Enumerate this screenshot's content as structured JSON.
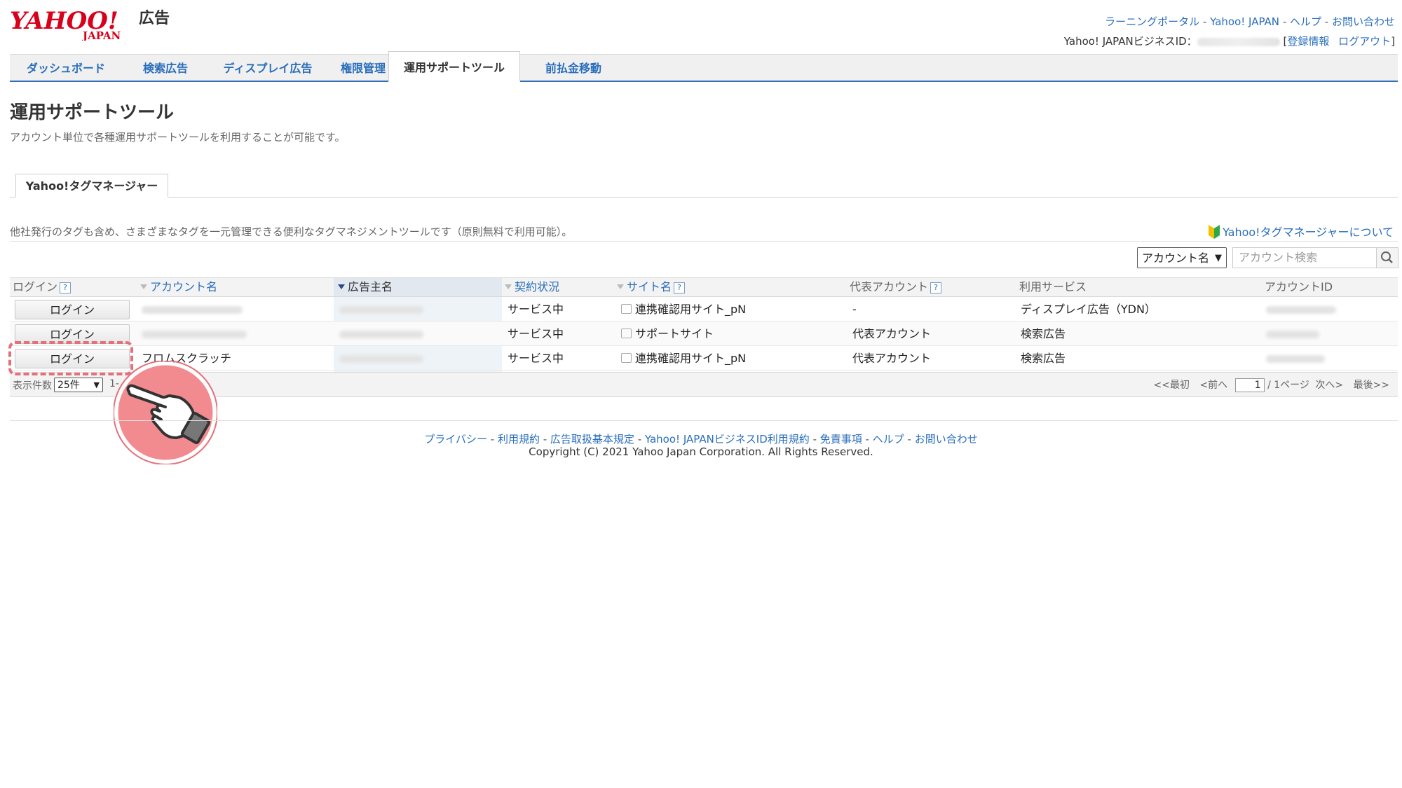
{
  "header": {
    "logo_main": "YAHOO!",
    "logo_sub": "JAPAN",
    "logo_suffix": "広告",
    "links": [
      "ラーニングポータル",
      "Yahoo! JAPAN",
      "ヘルプ",
      "お問い合わせ"
    ],
    "id_label": "Yahoo! JAPANビジネスID：",
    "account_info": "登録情報",
    "logout": "ログアウト"
  },
  "nav": {
    "tabs": [
      "ダッシュボード",
      "検索広告",
      "ディスプレイ広告",
      "権限管理",
      "運用サポートツール",
      "前払金移動"
    ],
    "active": "運用サポートツール"
  },
  "page": {
    "title": "運用サポートツール",
    "description": "アカウント単位で各種運用サポートツールを利用することが可能です。",
    "subtab": "Yahoo!タグマネージャー",
    "intro": "他社発行のタグも含め、さまざまなタグを一元管理できる便利なタグマネジメントツールです（原則無料で利用可能）。",
    "about_link": "Yahoo!タグマネージャーについて"
  },
  "search": {
    "select_value": "アカウント名",
    "placeholder": "アカウント検索",
    "button_icon": "search-icon"
  },
  "table": {
    "headers": {
      "login": "ログイン",
      "account_name": "アカウント名",
      "advertiser": "広告主名",
      "contract": "契約状況",
      "site": "サイト名",
      "representative": "代表アカウント",
      "service": "利用サービス",
      "account_id": "アカウントID"
    },
    "rows": [
      {
        "login": "ログイン",
        "account_name": "",
        "contract": "サービス中",
        "site": "連携確認用サイト_pN",
        "representative": "-",
        "service": "ディスプレイ広告（YDN）"
      },
      {
        "login": "ログイン",
        "account_name": "",
        "contract": "サービス中",
        "site": "サポートサイト",
        "representative": "代表アカウント",
        "service": "検索広告"
      },
      {
        "login": "ログイン",
        "account_name": "フロムスクラッチ",
        "contract": "サービス中",
        "site": "連携確認用サイト_pN",
        "representative": "代表アカウント",
        "service": "検索広告"
      }
    ]
  },
  "pager": {
    "per_page_label": "表示件数",
    "per_page_value": "25件",
    "range": "1-",
    "first": "<<最初",
    "prev": "<前へ",
    "page": "1",
    "total": "/ 1ページ",
    "next": "次へ>",
    "last": "最後>>"
  },
  "footer": {
    "links": [
      "プライバシー",
      "利用規約",
      "広告取扱基本規定",
      "Yahoo! JAPANビジネスID利用規約",
      "免責事項",
      "ヘルプ",
      "お問い合わせ"
    ],
    "copyright": "Copyright (C) 2021 Yahoo Japan Corporation. All Rights Reserved."
  },
  "colors": {
    "accent": "#2a6ebb",
    "logo_red": "#d8001b",
    "highlight": "#e3707a"
  }
}
